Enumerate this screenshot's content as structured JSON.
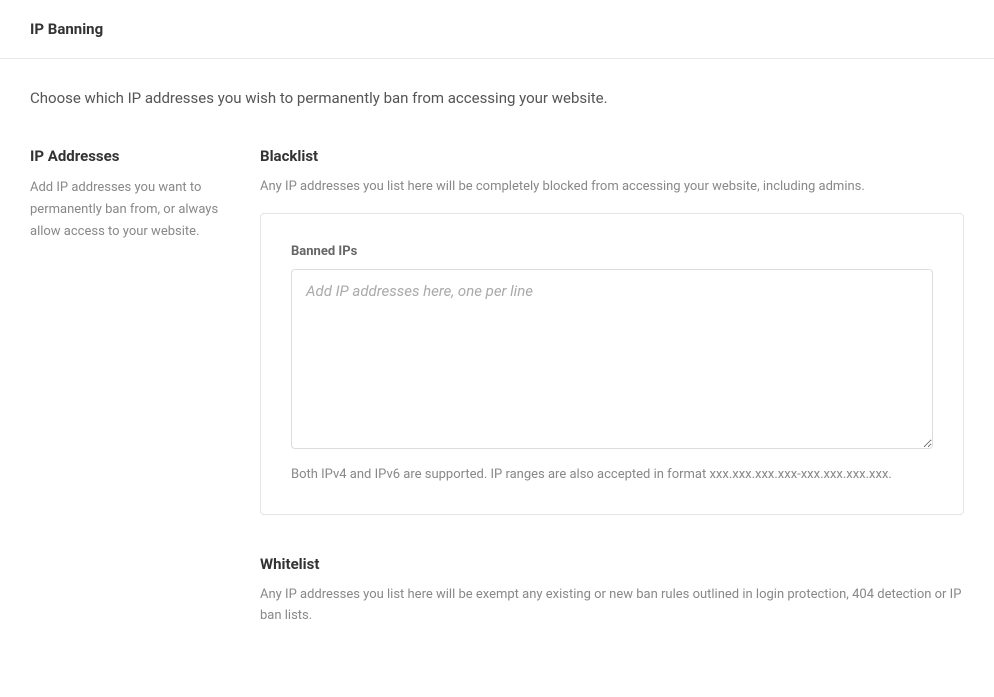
{
  "header": {
    "title": "IP Banning"
  },
  "intro": "Choose which IP addresses you wish to permanently ban from accessing your website.",
  "sidebar": {
    "title": "IP Addresses",
    "description": "Add IP addresses you want to permanently ban from, or always allow access to your website."
  },
  "blacklist": {
    "title": "Blacklist",
    "description": "Any IP addresses you list here will be completely blocked from accessing your website, including admins.",
    "field_label": "Banned IPs",
    "placeholder": "Add IP addresses here, one per line",
    "value": "",
    "help": "Both IPv4 and IPv6 are supported. IP ranges are also accepted in format xxx.xxx.xxx.xxx-xxx.xxx.xxx.xxx."
  },
  "whitelist": {
    "title": "Whitelist",
    "description": "Any IP addresses you list here will be exempt any existing or new ban rules outlined in login protection, 404 detection or IP ban lists."
  }
}
